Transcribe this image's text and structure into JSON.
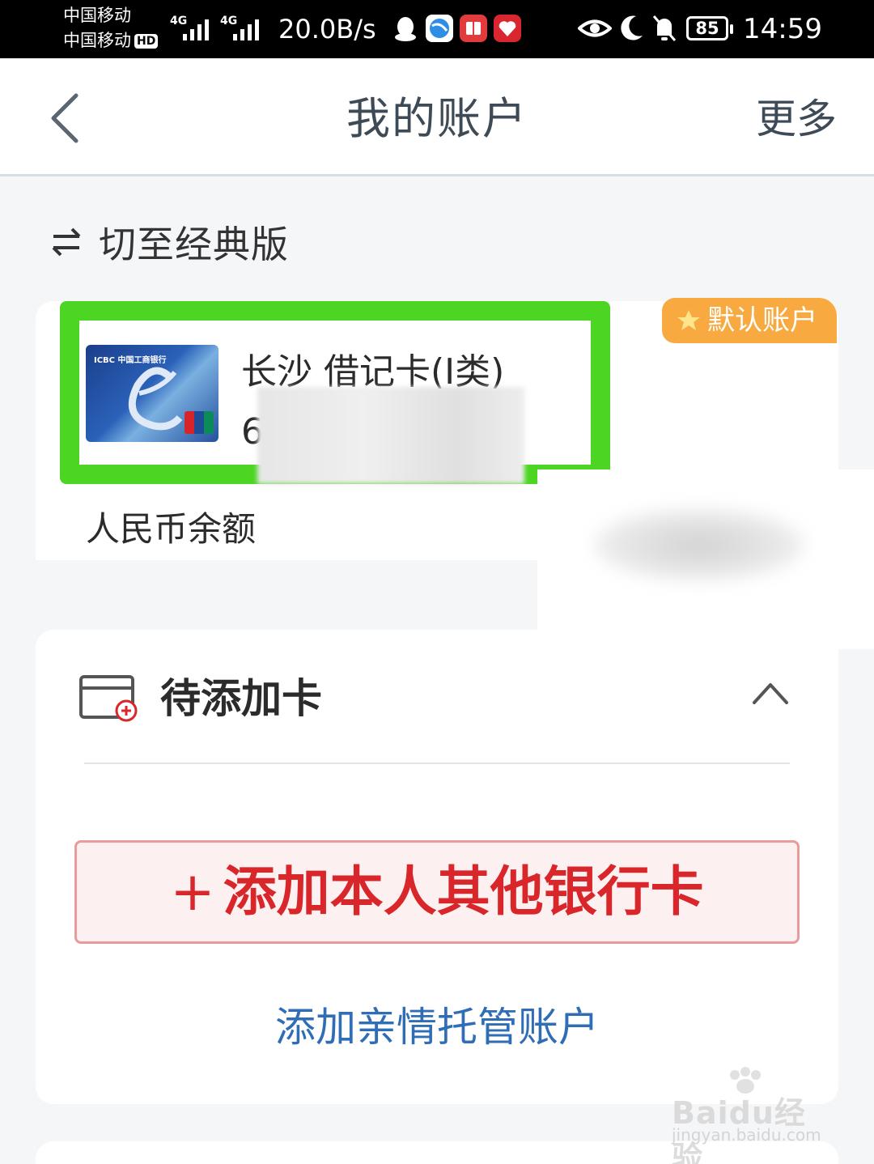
{
  "status_bar": {
    "carrier_1": "中国移动",
    "carrier_2": "中国移动",
    "hd_badge": "HD",
    "signal_tag_1": "4G",
    "signal_tag_2": "4G",
    "net_speed": "20.0B/s",
    "battery": "85",
    "time": "14:59"
  },
  "nav": {
    "title": "我的账户",
    "more": "更多"
  },
  "switch": {
    "label": "切至经典版"
  },
  "account": {
    "default_badge": "默认账户",
    "card_name": "长沙 借记卡(I类)",
    "card_number_prefix": "6",
    "card_logo_text": "ICBC 中国工商银行",
    "balance_label": "人民币余额"
  },
  "pending": {
    "title": "待添加卡",
    "add_card_plus": "+",
    "add_card_label": "添加本人其他银行卡",
    "add_family_label": "添加亲情托管账户"
  },
  "watermark": {
    "main": "Baidu经验",
    "sub": "jingyan.baidu.com"
  },
  "colors": {
    "accent_red": "#d8262b",
    "link_blue": "#2f6db6",
    "highlight_green": "#4cd623",
    "badge_orange": "#f8a940"
  }
}
